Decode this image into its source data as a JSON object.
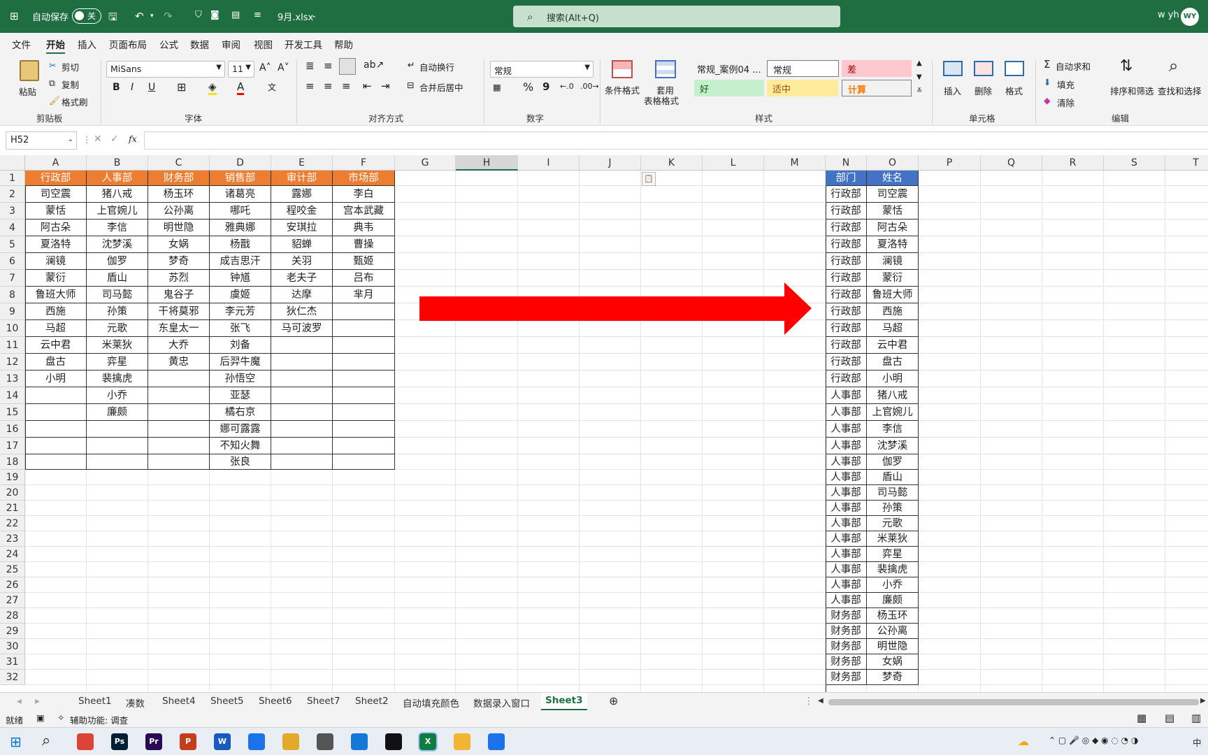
{
  "title_bar": {
    "autosave_label": "自动保存",
    "autosave_state": "关",
    "filename": "9月.xlsx",
    "search_placeholder": "搜索(Alt+Q)",
    "user_name": "w yh",
    "user_initials": "WY",
    "accent": "#1e6e42"
  },
  "menu": {
    "items": [
      "文件",
      "开始",
      "插入",
      "页面布局",
      "公式",
      "数据",
      "审阅",
      "视图",
      "开发工具",
      "帮助"
    ],
    "selected": "开始"
  },
  "ribbon": {
    "clipboard": {
      "paste": "粘贴",
      "cut": "剪切",
      "copy": "复制",
      "format_painter": "格式刷",
      "group": "剪贴板"
    },
    "font": {
      "name": "MiSans",
      "size": "11",
      "bold": "B",
      "italic": "I",
      "underline": "U",
      "group": "字体"
    },
    "alignment": {
      "wrap": "自动换行",
      "merge": "合并后居中",
      "group": "对齐方式"
    },
    "number": {
      "format": "常规",
      "percent": "%",
      "comma": "9",
      "group": "数字"
    },
    "styles": {
      "conditional": "条件格式",
      "table_format_1": "套用",
      "table_format_2": "表格格式",
      "cells": [
        {
          "label": "常规_案例04 ...",
          "bg": "#f3f3f3",
          "color": "#222"
        },
        {
          "label": "常规",
          "bg": "#ffffff",
          "color": "#222"
        },
        {
          "label": "差",
          "bg": "#ffc7ce",
          "color": "#9c0006"
        },
        {
          "label": "好",
          "bg": "#c6efce",
          "color": "#006100"
        },
        {
          "label": "适中",
          "bg": "#ffeb9c",
          "color": "#9c5700"
        },
        {
          "label": "计算",
          "bg": "#f2f2f2",
          "color": "#fa7d00"
        }
      ],
      "group": "样式"
    },
    "cells": {
      "insert": "插入",
      "delete": "删除",
      "format": "格式",
      "group": "单元格"
    },
    "editing": {
      "autosum": "自动求和",
      "fill": "填充",
      "clear": "清除",
      "sort_filter": "排序和筛选",
      "find_select": "查找和选择",
      "group": "编辑"
    }
  },
  "formula_bar": {
    "name_box": "H52",
    "fx": "fx",
    "value": ""
  },
  "grid": {
    "columns": [
      "A",
      "B",
      "C",
      "D",
      "E",
      "F",
      "G",
      "H",
      "I",
      "J",
      "K",
      "L",
      "M",
      "N",
      "O",
      "P",
      "Q",
      "R",
      "S",
      "T"
    ],
    "rows": [
      "1",
      "2",
      "3",
      "4",
      "5",
      "6",
      "7",
      "8",
      "9",
      "10",
      "11",
      "12",
      "13",
      "14",
      "15",
      "16",
      "17",
      "18",
      "19",
      "20",
      "21",
      "22",
      "23",
      "24",
      "25",
      "26",
      "27",
      "28",
      "29",
      "30",
      "31",
      "32"
    ],
    "selected_column": "H",
    "left_table": {
      "headers": [
        "行政部",
        "人事部",
        "财务部",
        "销售部",
        "审计部",
        "市场部"
      ],
      "rows": [
        [
          "司空震",
          "猪八戒",
          "杨玉环",
          "诸葛亮",
          "露娜",
          "李白"
        ],
        [
          "蒙恬",
          "上官婉儿",
          "公孙离",
          "哪吒",
          "程咬金",
          "宫本武藏"
        ],
        [
          "阿古朵",
          "李信",
          "明世隐",
          "雅典娜",
          "安琪拉",
          "典韦"
        ],
        [
          "夏洛特",
          "沈梦溪",
          "女娲",
          "杨戬",
          "貂蝉",
          "曹操"
        ],
        [
          "澜镜",
          "伽罗",
          "梦奇",
          "成吉思汗",
          "关羽",
          "甄姬"
        ],
        [
          "蒙衍",
          "盾山",
          "苏烈",
          "钟馗",
          "老夫子",
          "吕布"
        ],
        [
          "鲁班大师",
          "司马懿",
          "鬼谷子",
          "虞姬",
          "达摩",
          "芈月"
        ],
        [
          "西施",
          "孙策",
          "干将莫邪",
          "李元芳",
          "狄仁杰",
          ""
        ],
        [
          "马超",
          "元歌",
          "东皇太一",
          "张飞",
          "马可波罗",
          ""
        ],
        [
          "云中君",
          "米莱狄",
          "大乔",
          "刘备",
          "",
          ""
        ],
        [
          "盘古",
          "弈星",
          "黄忠",
          "后羿牛魔",
          "",
          ""
        ],
        [
          "小明",
          "裴擒虎",
          "",
          "孙悟空",
          "",
          ""
        ],
        [
          "",
          "小乔",
          "",
          "亚瑟",
          "",
          ""
        ],
        [
          "",
          "廉颇",
          "",
          "橘右京",
          "",
          ""
        ],
        [
          "",
          "",
          "",
          "娜可露露",
          "",
          ""
        ],
        [
          "",
          "",
          "",
          "不知火舞",
          "",
          ""
        ],
        [
          "",
          "",
          "",
          "张良",
          "",
          ""
        ]
      ]
    },
    "right_table": {
      "headers": [
        "部门",
        "姓名"
      ],
      "rows": [
        [
          "行政部",
          "司空震"
        ],
        [
          "行政部",
          "蒙恬"
        ],
        [
          "行政部",
          "阿古朵"
        ],
        [
          "行政部",
          "夏洛特"
        ],
        [
          "行政部",
          "澜镜"
        ],
        [
          "行政部",
          "蒙衍"
        ],
        [
          "行政部",
          "鲁班大师"
        ],
        [
          "行政部",
          "西施"
        ],
        [
          "行政部",
          "马超"
        ],
        [
          "行政部",
          "云中君"
        ],
        [
          "行政部",
          "盘古"
        ],
        [
          "行政部",
          "小明"
        ],
        [
          "人事部",
          "猪八戒"
        ],
        [
          "人事部",
          "上官婉儿"
        ],
        [
          "人事部",
          "李信"
        ],
        [
          "人事部",
          "沈梦溪"
        ],
        [
          "人事部",
          "伽罗"
        ],
        [
          "人事部",
          "盾山"
        ],
        [
          "人事部",
          "司马懿"
        ],
        [
          "人事部",
          "孙策"
        ],
        [
          "人事部",
          "元歌"
        ],
        [
          "人事部",
          "米莱狄"
        ],
        [
          "人事部",
          "弈星"
        ],
        [
          "人事部",
          "裴擒虎"
        ],
        [
          "人事部",
          "小乔"
        ],
        [
          "人事部",
          "廉颇"
        ],
        [
          "财务部",
          "杨玉环"
        ],
        [
          "财务部",
          "公孙离"
        ],
        [
          "财务部",
          "明世隐"
        ],
        [
          "财务部",
          "女娲"
        ],
        [
          "财务部",
          "梦奇"
        ]
      ]
    },
    "arrow_color": "#ff0000",
    "header_orange": "#ed7d31",
    "header_blue": "#4472c4"
  },
  "sheet_tabs": {
    "tabs": [
      "Sheet1",
      "凑数",
      "Sheet4",
      "Sheet5",
      "Sheet6",
      "Sheet7",
      "Sheet2",
      "自动填充颜色",
      "数据录入窗口",
      "Sheet3"
    ],
    "active": "Sheet3"
  },
  "status_bar": {
    "ready": "就绪",
    "accessibility": "辅助功能: 调查"
  },
  "taskbar": {
    "apps": [
      {
        "name": "Chrome",
        "label": "",
        "color": "#db4437"
      },
      {
        "name": "Photoshop",
        "label": "Ps",
        "color": "#001e36"
      },
      {
        "name": "Premiere",
        "label": "Pr",
        "color": "#2a0a54"
      },
      {
        "name": "PowerPoint",
        "label": "P",
        "color": "#c43e1c"
      },
      {
        "name": "Word",
        "label": "W",
        "color": "#185abd"
      },
      {
        "name": "QQ Browser",
        "label": "",
        "color": "#1a73e8"
      },
      {
        "name": "Files",
        "label": "",
        "color": "#e3a92b"
      },
      {
        "name": "Media",
        "label": "",
        "color": "#555555"
      },
      {
        "name": "Video",
        "label": "",
        "color": "#1577d6"
      },
      {
        "name": "CapCut",
        "label": "",
        "color": "#111111"
      },
      {
        "name": "Excel",
        "label": "X",
        "color": "#107c41"
      },
      {
        "name": "Explorer",
        "label": "",
        "color": "#f2b531"
      },
      {
        "name": "QQ",
        "label": "",
        "color": "#1a73e8"
      }
    ],
    "tray_text": "中"
  }
}
